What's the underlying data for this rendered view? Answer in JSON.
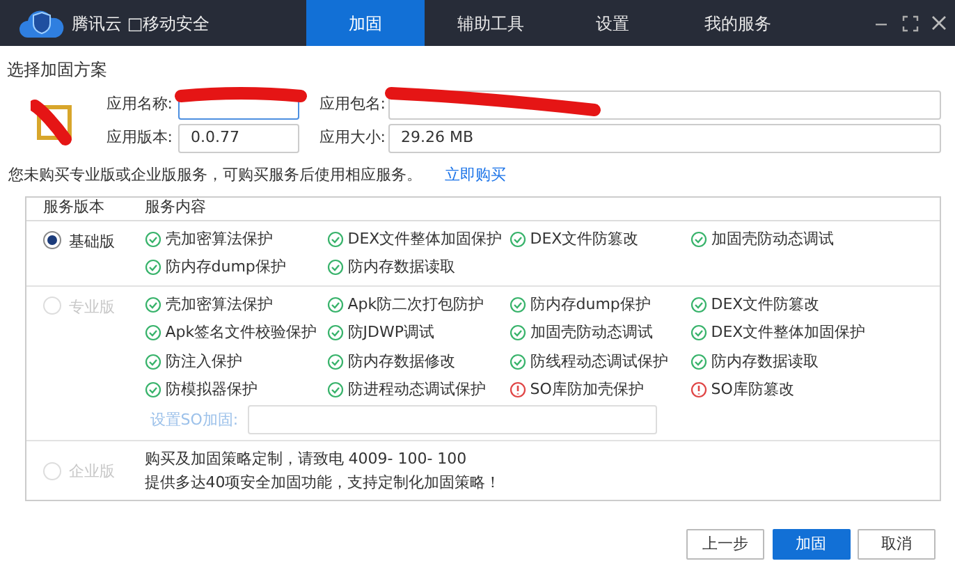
{
  "titlebar": {
    "app_name": "腾讯云 □移动安全",
    "tabs": [
      {
        "label": "加固",
        "selected": true
      },
      {
        "label": "辅助工具",
        "selected": false
      },
      {
        "label": "设置",
        "selected": false
      },
      {
        "label": "我的服务",
        "selected": false
      }
    ]
  },
  "section_title": "选择加固方案",
  "app_fields": [
    {
      "label": "应用名称:",
      "redacted": true
    },
    {
      "label": "应用包名:",
      "redacted": true
    },
    {
      "label": "应用版本:",
      "value": "0.0.77"
    },
    {
      "label": "应用大小:",
      "value": "29.26 MB"
    }
  ],
  "notice": {
    "text": "您未购买专业版或企业版服务，可购买服务后使用相应服务。",
    "link": "立即购买"
  },
  "table": {
    "columns": [
      "服务版本",
      "服务内容"
    ],
    "rows": [
      {
        "version": "基础版",
        "selected": true,
        "disabled": false,
        "features": [
          {
            "text": "壳加密算法保护",
            "kind": "ok"
          },
          {
            "text": "DEX文件整体加固保护",
            "kind": "ok"
          },
          {
            "text": "DEX文件防篡改",
            "kind": "ok"
          },
          {
            "text": "加固壳防动态调试",
            "kind": "ok"
          },
          {
            "text": "防内存dump保护",
            "kind": "ok"
          },
          {
            "text": "防内存数据读取",
            "kind": "ok"
          }
        ]
      },
      {
        "version": "专业版",
        "selected": false,
        "disabled": true,
        "features": [
          {
            "text": "壳加密算法保护",
            "kind": "ok"
          },
          {
            "text": "Apk防二次打包防护",
            "kind": "ok"
          },
          {
            "text": "防内存dump保护",
            "kind": "ok"
          },
          {
            "text": "DEX文件防篡改",
            "kind": "ok"
          },
          {
            "text": "Apk签名文件校验保护",
            "kind": "ok"
          },
          {
            "text": "防JDWP调试",
            "kind": "ok"
          },
          {
            "text": "加固壳防动态调试",
            "kind": "ok"
          },
          {
            "text": "DEX文件整体加固保护",
            "kind": "ok"
          },
          {
            "text": "防注入保护",
            "kind": "ok"
          },
          {
            "text": "防内存数据修改",
            "kind": "ok"
          },
          {
            "text": "防线程动态调试保护",
            "kind": "ok"
          },
          {
            "text": "防内存数据读取",
            "kind": "ok"
          },
          {
            "text": "防模拟器保护",
            "kind": "ok"
          },
          {
            "text": "防进程动态调试保护",
            "kind": "ok"
          },
          {
            "text": "SO库防加壳保护",
            "kind": "warn"
          },
          {
            "text": "SO库防篡改",
            "kind": "warn"
          }
        ],
        "so_setting": {
          "label": "设置SO加固:"
        }
      },
      {
        "version": "企业版",
        "selected": false,
        "disabled": true,
        "description": [
          "购买及加固策略定制，请致电 4009- 100- 100",
          "提供多达40项安全加固功能，支持定制化加固策略！"
        ]
      }
    ]
  },
  "buttons": [
    {
      "label": "上一步",
      "kind": "default"
    },
    {
      "label": "加固",
      "kind": "primary"
    },
    {
      "label": "取消",
      "kind": "default"
    }
  ]
}
